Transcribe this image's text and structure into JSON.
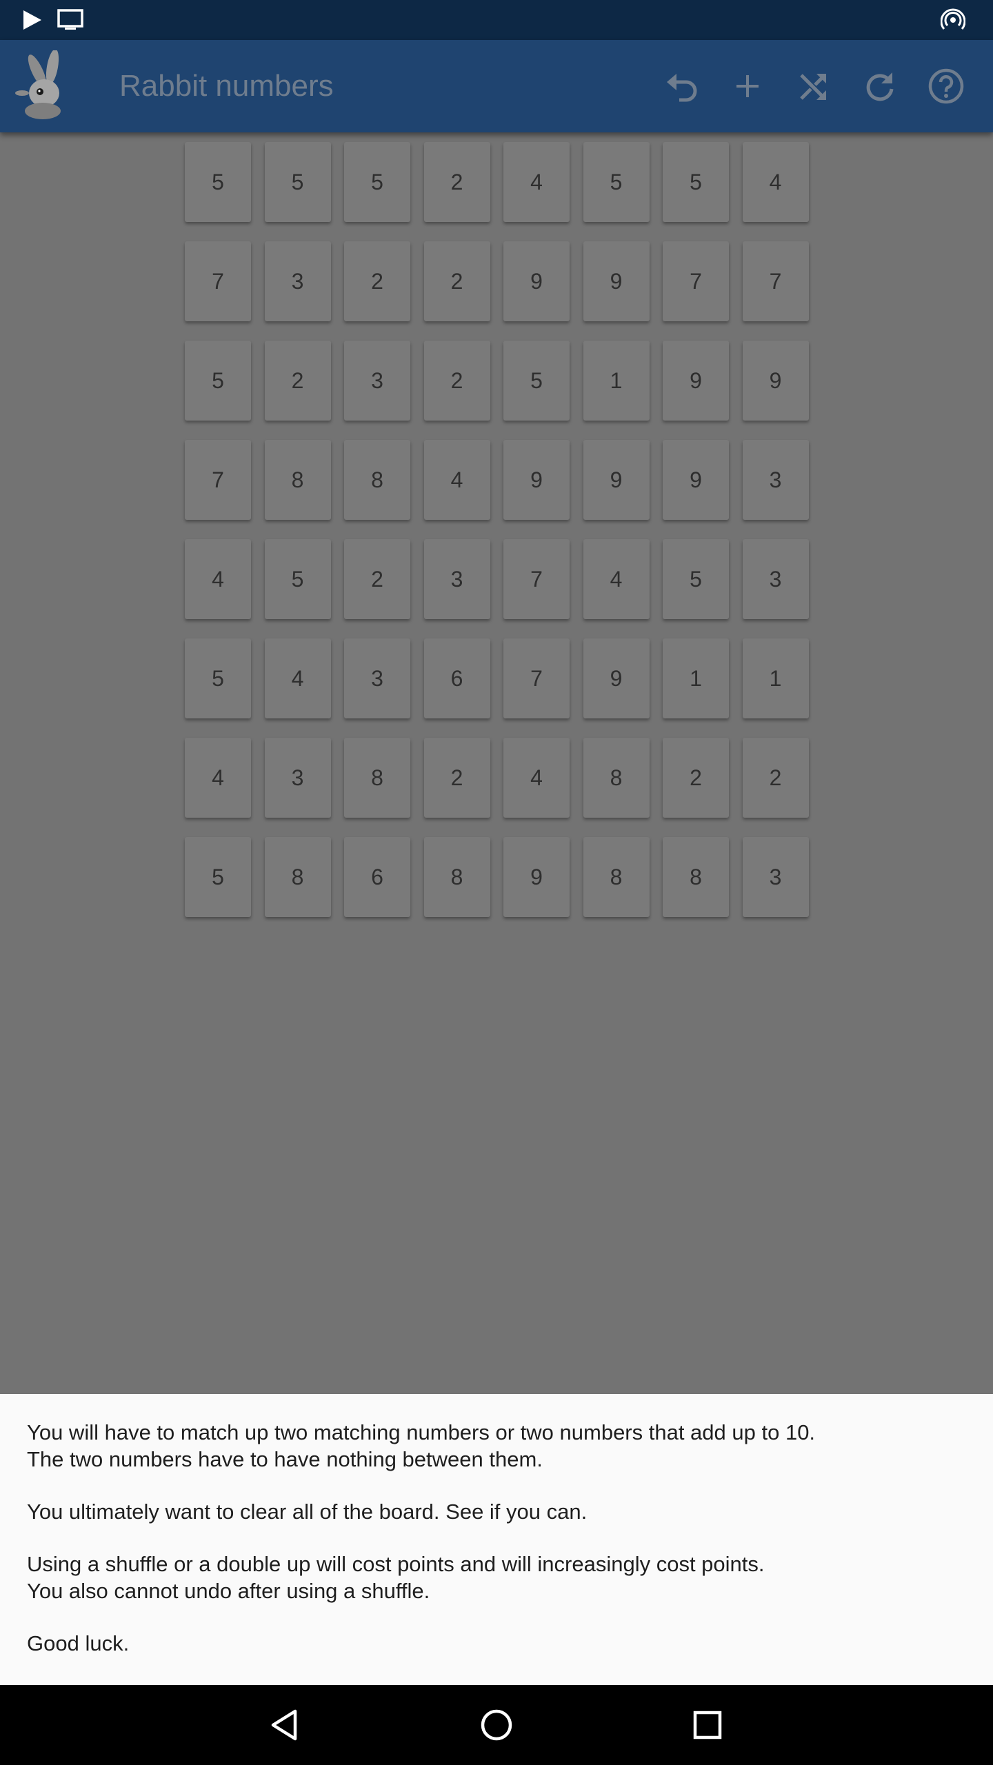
{
  "status_bar": {
    "icons": [
      "play-icon",
      "cast-screen-icon",
      "hotspot-icon"
    ]
  },
  "app_bar": {
    "title": "Rabbit numbers",
    "logo": "rabbit-logo",
    "actions": [
      "undo-icon",
      "add-icon",
      "shuffle-icon",
      "refresh-icon",
      "help-icon"
    ],
    "colors": {
      "background": "#1f4470",
      "title": "#6f7d8e",
      "icons": "#6f7d8e"
    }
  },
  "board": {
    "rows": [
      [
        "5",
        "5",
        "5",
        "2",
        "4",
        "5",
        "5",
        "4"
      ],
      [
        "7",
        "3",
        "2",
        "2",
        "9",
        "9",
        "7",
        "7"
      ],
      [
        "5",
        "2",
        "3",
        "2",
        "5",
        "1",
        "9",
        "9"
      ],
      [
        "7",
        "8",
        "8",
        "4",
        "9",
        "9",
        "9",
        "3"
      ],
      [
        "4",
        "5",
        "2",
        "3",
        "7",
        "4",
        "5",
        "3"
      ],
      [
        "5",
        "4",
        "3",
        "6",
        "7",
        "9",
        "1",
        "1"
      ],
      [
        "4",
        "3",
        "8",
        "2",
        "4",
        "8",
        "2",
        "2"
      ],
      [
        "5",
        "8",
        "6",
        "8",
        "9",
        "8",
        "8",
        "3"
      ]
    ]
  },
  "help": {
    "para1_line1": "You will have to match up two matching numbers or two numbers that add up to 10.",
    "para1_line2": "The two numbers have to have nothing between them.",
    "para2": "You ultimately want to clear all of the board. See if you can.",
    "para3_line1": "Using a shuffle or a double up will cost points and will increasingly cost points.",
    "para3_line2": "You also cannot undo after using a shuffle.",
    "para4": "Good luck."
  },
  "nav_bar": {
    "buttons": [
      "back-icon",
      "home-icon",
      "recents-icon"
    ]
  }
}
